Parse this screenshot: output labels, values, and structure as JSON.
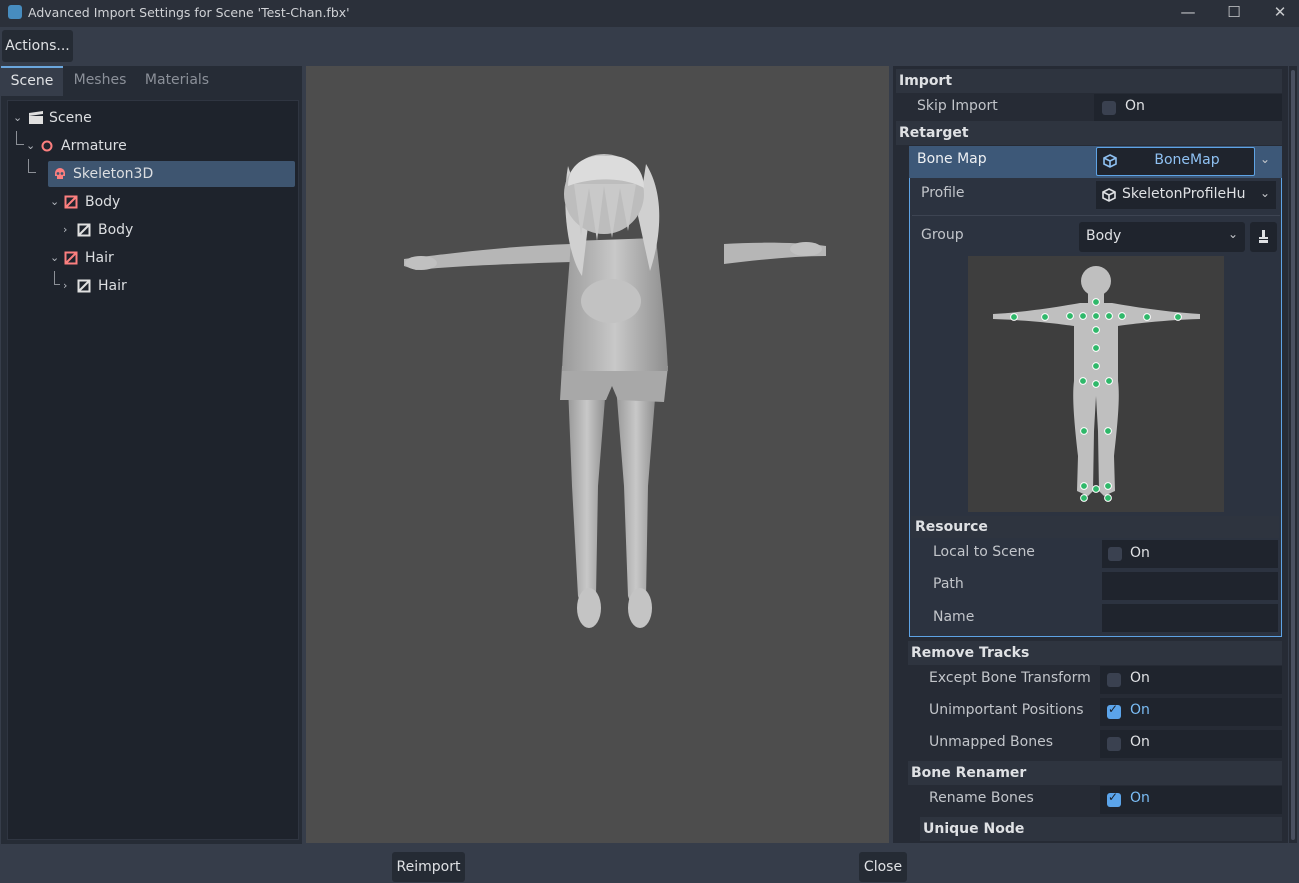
{
  "window": {
    "title": "Advanced Import Settings for Scene 'Test-Chan.fbx'",
    "minimize_glyph": "—",
    "maximize_glyph": "☐",
    "close_glyph": "✕"
  },
  "toolbar": {
    "actions_label": "Actions..."
  },
  "tabs": [
    "Scene",
    "Meshes",
    "Materials"
  ],
  "tree": [
    {
      "label": "Scene",
      "icon": "scene-icon"
    },
    {
      "label": "Armature",
      "icon": "node3d-icon"
    },
    {
      "label": "Skeleton3D",
      "icon": "skeleton-icon"
    },
    {
      "label": "Body",
      "icon": "mesh-instance-icon"
    },
    {
      "label": "Body",
      "icon": "mesh-icon"
    },
    {
      "label": "Hair",
      "icon": "mesh-instance-icon"
    },
    {
      "label": "Hair",
      "icon": "mesh-icon"
    }
  ],
  "inspector": {
    "import_section": "Import",
    "skip_import": {
      "label": "Skip Import",
      "value": "On",
      "checked": false
    },
    "retarget_section": "Retarget",
    "bone_map": {
      "label": "Bone Map",
      "value": "BoneMap"
    },
    "profile": {
      "label": "Profile",
      "value": "SkeletonProfileHu"
    },
    "group": {
      "label": "Group",
      "value": "Body"
    },
    "resource_section": "Resource",
    "local_to_scene": {
      "label": "Local to Scene",
      "value": "On",
      "checked": false
    },
    "path": {
      "label": "Path",
      "value": ""
    },
    "name": {
      "label": "Name",
      "value": ""
    },
    "remove_tracks_section": "Remove Tracks",
    "except_bone_transform": {
      "label": "Except Bone Transform",
      "value": "On",
      "checked": false
    },
    "unimportant_positions": {
      "label": "Unimportant Positions",
      "value": "On",
      "checked": true
    },
    "unmapped_bones": {
      "label": "Unmapped Bones",
      "value": "On",
      "checked": false
    },
    "bone_renamer_section": "Bone Renamer",
    "rename_bones": {
      "label": "Rename Bones",
      "value": "On",
      "checked": true
    },
    "unique_node_section": "Unique Node"
  },
  "buttons": {
    "reimport": "Reimport",
    "close": "Close"
  },
  "colors": {
    "accent": "#5ea3e5",
    "bone_dot": "#2fb86a",
    "selection": "#3e5570"
  }
}
